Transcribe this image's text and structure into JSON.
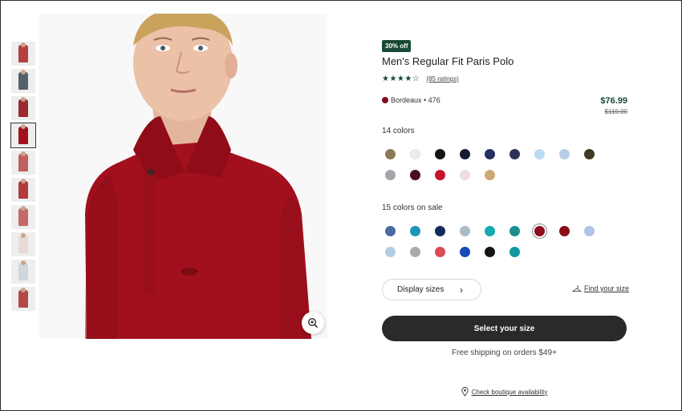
{
  "product": {
    "badge": "30% off",
    "title": "Men's Regular Fit Paris Polo",
    "stars": "★★★★☆",
    "rating_value": 4.5,
    "ratings_link": "(85 ratings)",
    "selected_color": "Bordeaux • 476",
    "selected_color_hex": "#7a0f18",
    "price": "$76.99",
    "old_price": "$110.00"
  },
  "thumbnails": [
    {
      "color": "#b5403f"
    },
    {
      "color": "#54606d"
    },
    {
      "color": "#9a2a2e"
    },
    {
      "color": "#a3101d",
      "selected": true
    },
    {
      "color": "#c06060"
    },
    {
      "color": "#b23a3a"
    },
    {
      "color": "#c46a66"
    },
    {
      "color": "#e7dcd5"
    },
    {
      "color": "#cfd6dc"
    },
    {
      "color": "#b44a43"
    }
  ],
  "colors": {
    "label": "14 colors",
    "swatches": [
      "#8b7a58",
      "#ecebf0",
      "#141414",
      "#141b2e",
      "#24305e",
      "#2c3557",
      "#b9daf3",
      "#b5cee5",
      "#3f3a24",
      "#a3a7ab",
      "#4a0f1a",
      "#c8142b",
      "#f2dcdc",
      "#cfa874"
    ]
  },
  "sale_colors": {
    "label": "15 colors on sale",
    "swatches": [
      "#4a6aa2",
      "#1a96b8",
      "#142a5c",
      "#a9bcc6",
      "#15a9b2",
      "#1a8f8e",
      "#8e0d1d",
      "#8a0e18",
      "#b1c3e6",
      "#b2cae3",
      "#a9aaad",
      "#dc4a52",
      "#1a4ab8",
      "#141414",
      "#0e9a9e"
    ],
    "selected_index": 6
  },
  "actions": {
    "display_sizes": "Display sizes",
    "chevron": "›",
    "find_size": "Find your size",
    "select_size": "Select your size",
    "shipping": "Free shipping on orders $49+",
    "boutique": "Check boutique availability"
  }
}
